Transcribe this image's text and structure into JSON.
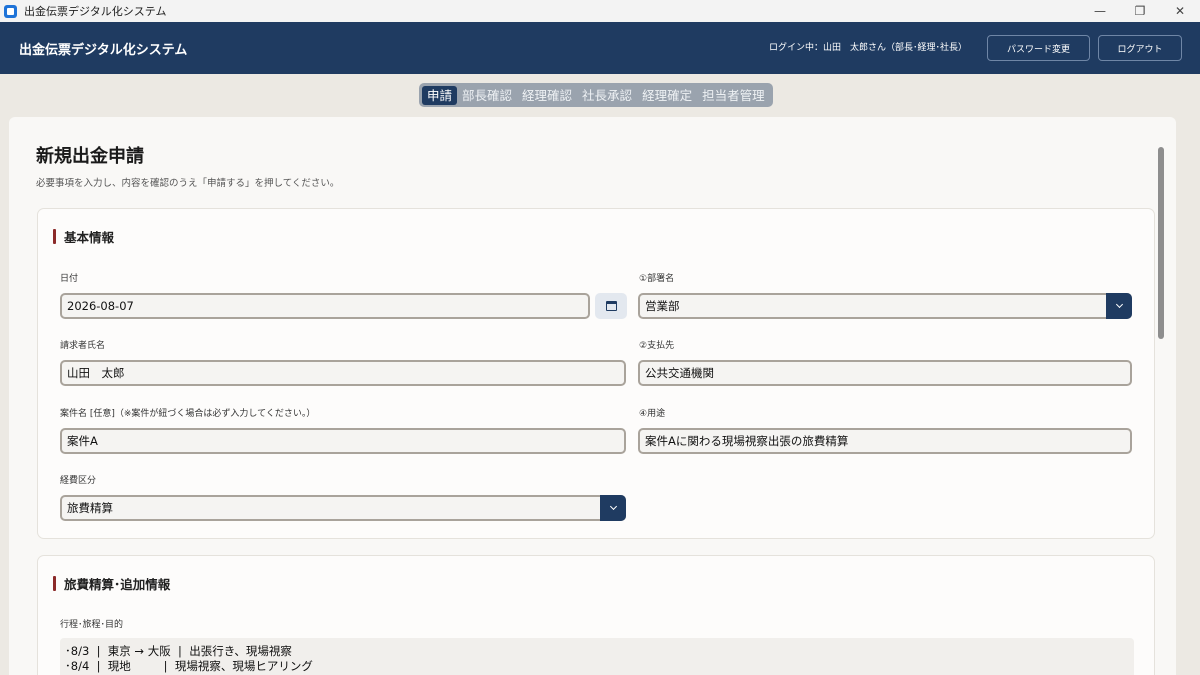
{
  "window": {
    "title": "出金伝票デジタル化システム",
    "controls": {
      "minimize": "—",
      "restore": "❐",
      "close": "✕"
    }
  },
  "header": {
    "title": "出金伝票デジタル化システム",
    "login_info": "ログイン中：山田　太郎さん（部長･経理･社長）",
    "password_button": "パスワード変更",
    "logout_button": "ログアウト"
  },
  "tabs": [
    {
      "label": "申請",
      "active": true
    },
    {
      "label": "部長確認",
      "active": false
    },
    {
      "label": "経理確認",
      "active": false
    },
    {
      "label": "社長承認",
      "active": false
    },
    {
      "label": "経理確定",
      "active": false
    },
    {
      "label": "担当者管理",
      "active": false
    }
  ],
  "page": {
    "title": "新規出金申請",
    "description": "必要事項を入力し、内容を確認のうえ「申請する」を押してください。"
  },
  "basic_info": {
    "heading": "基本情報",
    "date_label": "日付",
    "date_value": "2026-08-07",
    "department_label": "①部署名",
    "department_value": "営業部",
    "requester_label": "請求者氏名",
    "requester_value": "山田　太郎",
    "payee_label": "②支払先",
    "payee_value": "公共交通機関",
    "project_label": "案件名 [任意]（※案件が紐づく場合は必ず入力してください。）",
    "project_value": "案件A",
    "purpose_label": "④用途",
    "purpose_value": "案件Aに関わる現場視察出張の旅費精算",
    "expense_label": "経費区分",
    "expense_value": "旅費精算"
  },
  "travel_info": {
    "heading": "旅費精算･追加情報",
    "itinerary_label": "行程･旅程･目的",
    "itinerary_lines": [
      "･8/3  |  東京 → 大阪  |  出張行き、現場視察",
      "･8/4  |  現地         |  現場視察、現場ヒアリング"
    ]
  },
  "colors": {
    "header_bg": "#1f3b61",
    "accent_bar": "#8c2a2a",
    "page_bg": "#ece9e3"
  }
}
